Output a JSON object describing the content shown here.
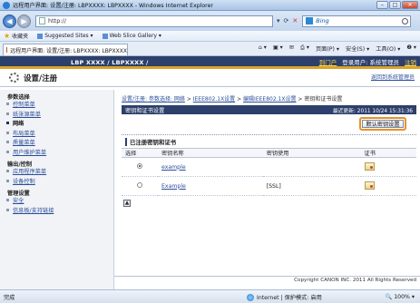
{
  "browser": {
    "window_title": "远程用户界面: 设置/注册: LBPXXXX: LBPXXXX - Windows Internet Explorer",
    "address": "http://",
    "search_placeholder": "Bing",
    "favorites_label": "收藏夹",
    "fav_items": [
      "Suggested Sites ▾",
      "Web Slice Gallery ▾"
    ],
    "tab_label": "远程用户界面: 设置/注册: LBPXXXX: LBPXXXX",
    "tools": [
      "页面(P) ▾",
      "安全(S) ▾",
      "工具(O) ▾",
      "❷ ▾"
    ],
    "status_left": "完成",
    "status_zone": "Internet | 保护模式: 启用",
    "status_zoom": "100% ▾"
  },
  "header": {
    "model": "LBP XXXX / LBPXXXX /",
    "portal_link": "到门户",
    "login_user": "登录用户: 系统管理员",
    "logout_link": "注销"
  },
  "titlearea": {
    "title": "设置/注册",
    "return_link": "返回到系统管理员"
  },
  "sidebar": {
    "groups": [
      {
        "label": "参数选择",
        "items": [
          {
            "label": "控制菜单",
            "active": false
          },
          {
            "label": "纸张源菜单",
            "active": false
          },
          {
            "label": "网络",
            "active": true
          },
          {
            "label": "布局菜单",
            "active": false
          },
          {
            "label": "质量菜单",
            "active": false
          },
          {
            "label": "用户维护菜单",
            "active": false
          }
        ]
      },
      {
        "label": "输出/控制",
        "items": [
          {
            "label": "应用程序菜单",
            "active": false
          },
          {
            "label": "设备控制",
            "active": false
          }
        ]
      },
      {
        "label": "管理设置",
        "items": [
          {
            "label": "安全",
            "active": false
          },
          {
            "label": "信息板/支持链接",
            "active": false
          }
        ]
      }
    ]
  },
  "main": {
    "breadcrumb": [
      "设置/注册: 参数选择: 网络",
      "IEEE802.1X设置",
      "编辑IEEE802.1X设置",
      "密钥和证书设置"
    ],
    "section_title": "密钥和证书设置",
    "last_updated": "最近更新: 2011 10/24 15:31:36",
    "default_button": "默认密钥设置",
    "registered_title": "已注册密钥和证书",
    "table_headers": [
      "选择",
      "密钥名称",
      "密钥使用",
      "证书"
    ],
    "rows": [
      {
        "selected": true,
        "key_name": "example",
        "usage": ""
      },
      {
        "selected": false,
        "key_name": "Example",
        "usage": "[SSL]"
      }
    ],
    "copyright": "Copyright CANON INC. 2011 All Rights Reserved"
  }
}
